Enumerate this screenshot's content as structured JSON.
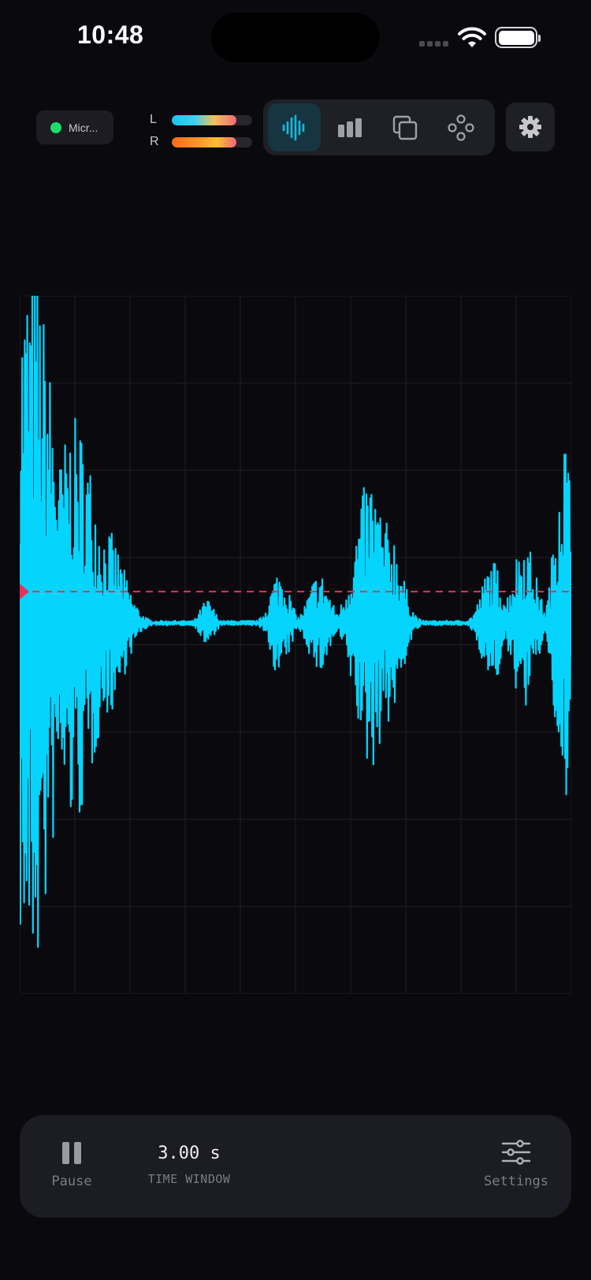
{
  "status_bar": {
    "time": "10:48"
  },
  "input": {
    "label": "Micr...",
    "active_color": "#1fdc6a"
  },
  "meters": {
    "left": {
      "label": "L",
      "level": 0.8
    },
    "right": {
      "label": "R",
      "level": 0.8
    }
  },
  "modes": [
    {
      "id": "waveform",
      "icon": "waveform-icon",
      "active": true
    },
    {
      "id": "spectrum",
      "icon": "bar-chart-icon",
      "active": false
    },
    {
      "id": "layers",
      "icon": "copy-layers-icon",
      "active": false
    },
    {
      "id": "nodes",
      "icon": "node-graph-icon",
      "active": false
    }
  ],
  "colors": {
    "background": "#0a0a0e",
    "waveform": "#05d4ff",
    "trigger": "#e8305c",
    "accent_active": "#1ab8e0"
  },
  "scope": {
    "trigger_level": 0.09
  },
  "controls": {
    "pause_label": "Pause",
    "time_window_value": "3.00 s",
    "time_window_label": "TIME WINDOW",
    "settings_label": "Settings"
  }
}
